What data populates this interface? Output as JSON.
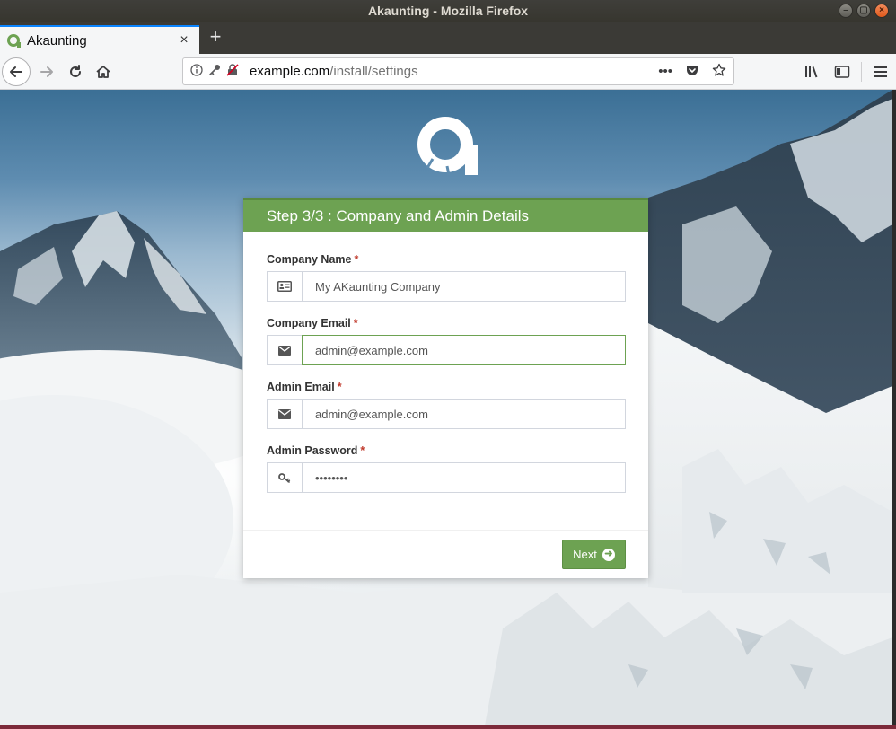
{
  "window": {
    "title": "Akaunting - Mozilla Firefox",
    "controls": [
      "minimize",
      "maximize",
      "close"
    ]
  },
  "tab": {
    "title": "Akaunting",
    "close_glyph": "×",
    "new_tab_glyph": "+"
  },
  "urlbar": {
    "host": "example.com",
    "path": "/install/settings",
    "more_glyph": "•••"
  },
  "card": {
    "header": "Step 3/3 : Company and Admin Details",
    "required_marker": "*",
    "fields": [
      {
        "label": "Company Name",
        "value": "My AKaunting Company",
        "icon": "id-card-icon"
      },
      {
        "label": "Company Email",
        "value": "admin@example.com",
        "icon": "envelope-icon"
      },
      {
        "label": "Admin Email",
        "value": "admin@example.com",
        "icon": "envelope-icon"
      },
      {
        "label": "Admin Password",
        "value": "••••••••",
        "icon": "key-icon"
      }
    ],
    "next_label": "Next"
  },
  "colors": {
    "accent": "#6da252",
    "required": "#c0392b",
    "firefox_blue": "#0a84ff"
  }
}
